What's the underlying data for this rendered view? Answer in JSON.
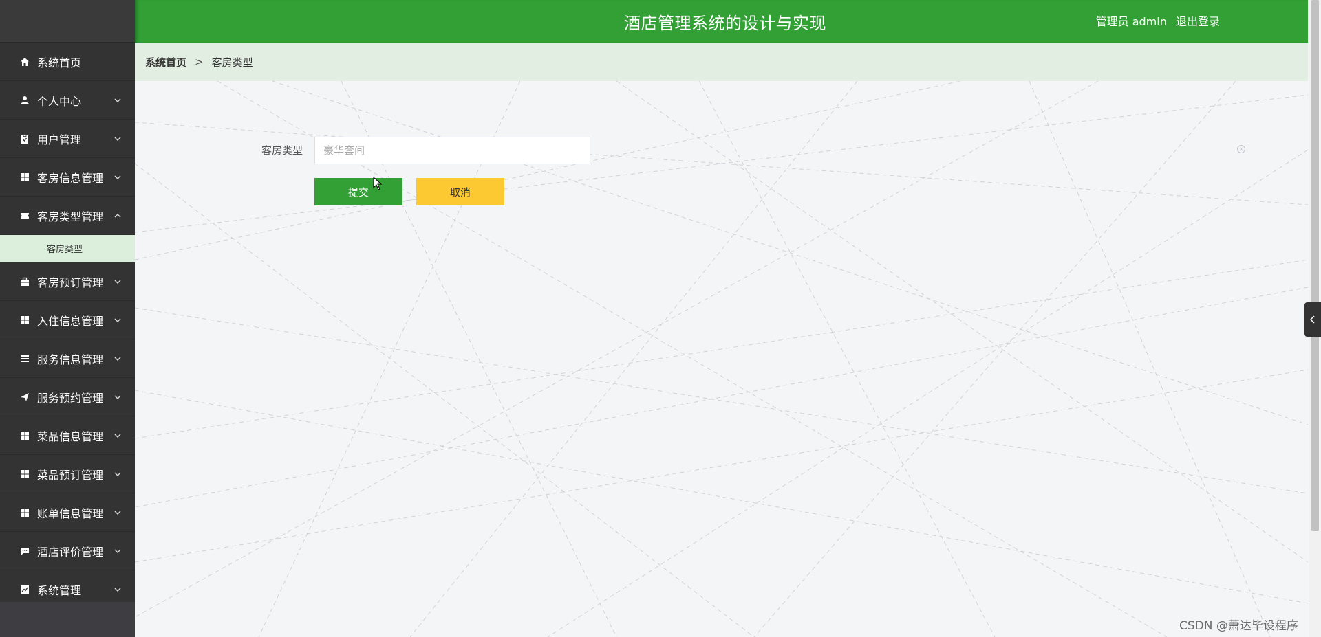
{
  "header": {
    "title": "酒店管理系统的设计与实现",
    "user_label": "管理员 admin",
    "logout": "退出登录"
  },
  "sidebar": {
    "items": [
      {
        "label": "系统首页",
        "icon": "home-icon",
        "expandable": false
      },
      {
        "label": "个人中心",
        "icon": "user-icon",
        "expandable": true
      },
      {
        "label": "用户管理",
        "icon": "clipboard-icon",
        "expandable": true
      },
      {
        "label": "客房信息管理",
        "icon": "grid-icon",
        "expandable": true
      },
      {
        "label": "客房类型管理",
        "icon": "ticket-icon",
        "expandable": true,
        "expanded": true,
        "children": [
          {
            "label": "客房类型"
          }
        ]
      },
      {
        "label": "客房预订管理",
        "icon": "briefcase-icon",
        "expandable": true
      },
      {
        "label": "入住信息管理",
        "icon": "grid-icon",
        "expandable": true
      },
      {
        "label": "服务信息管理",
        "icon": "list-icon",
        "expandable": true
      },
      {
        "label": "服务预约管理",
        "icon": "send-icon",
        "expandable": true
      },
      {
        "label": "菜品信息管理",
        "icon": "grid-icon",
        "expandable": true
      },
      {
        "label": "菜品预订管理",
        "icon": "grid-icon",
        "expandable": true
      },
      {
        "label": "账单信息管理",
        "icon": "grid-icon",
        "expandable": true
      },
      {
        "label": "酒店评价管理",
        "icon": "chat-icon",
        "expandable": true
      },
      {
        "label": "系统管理",
        "icon": "chart-icon",
        "expandable": true
      }
    ]
  },
  "breadcrumb": {
    "home": "系统首页",
    "separator": ">",
    "current": "客房类型"
  },
  "form": {
    "field_label": "客房类型",
    "field_value": "",
    "field_placeholder": "豪华套间",
    "submit_label": "提交",
    "cancel_label": "取消"
  },
  "watermark": "CSDN @萧达毕设程序",
  "colors": {
    "header_green": "#32a035",
    "sidebar_dark": "#333333",
    "submit_green": "#33a036",
    "cancel_yellow": "#fcc932",
    "breadcrumb_bg": "#e3eee3",
    "submenu_bg": "#dcefdc"
  }
}
